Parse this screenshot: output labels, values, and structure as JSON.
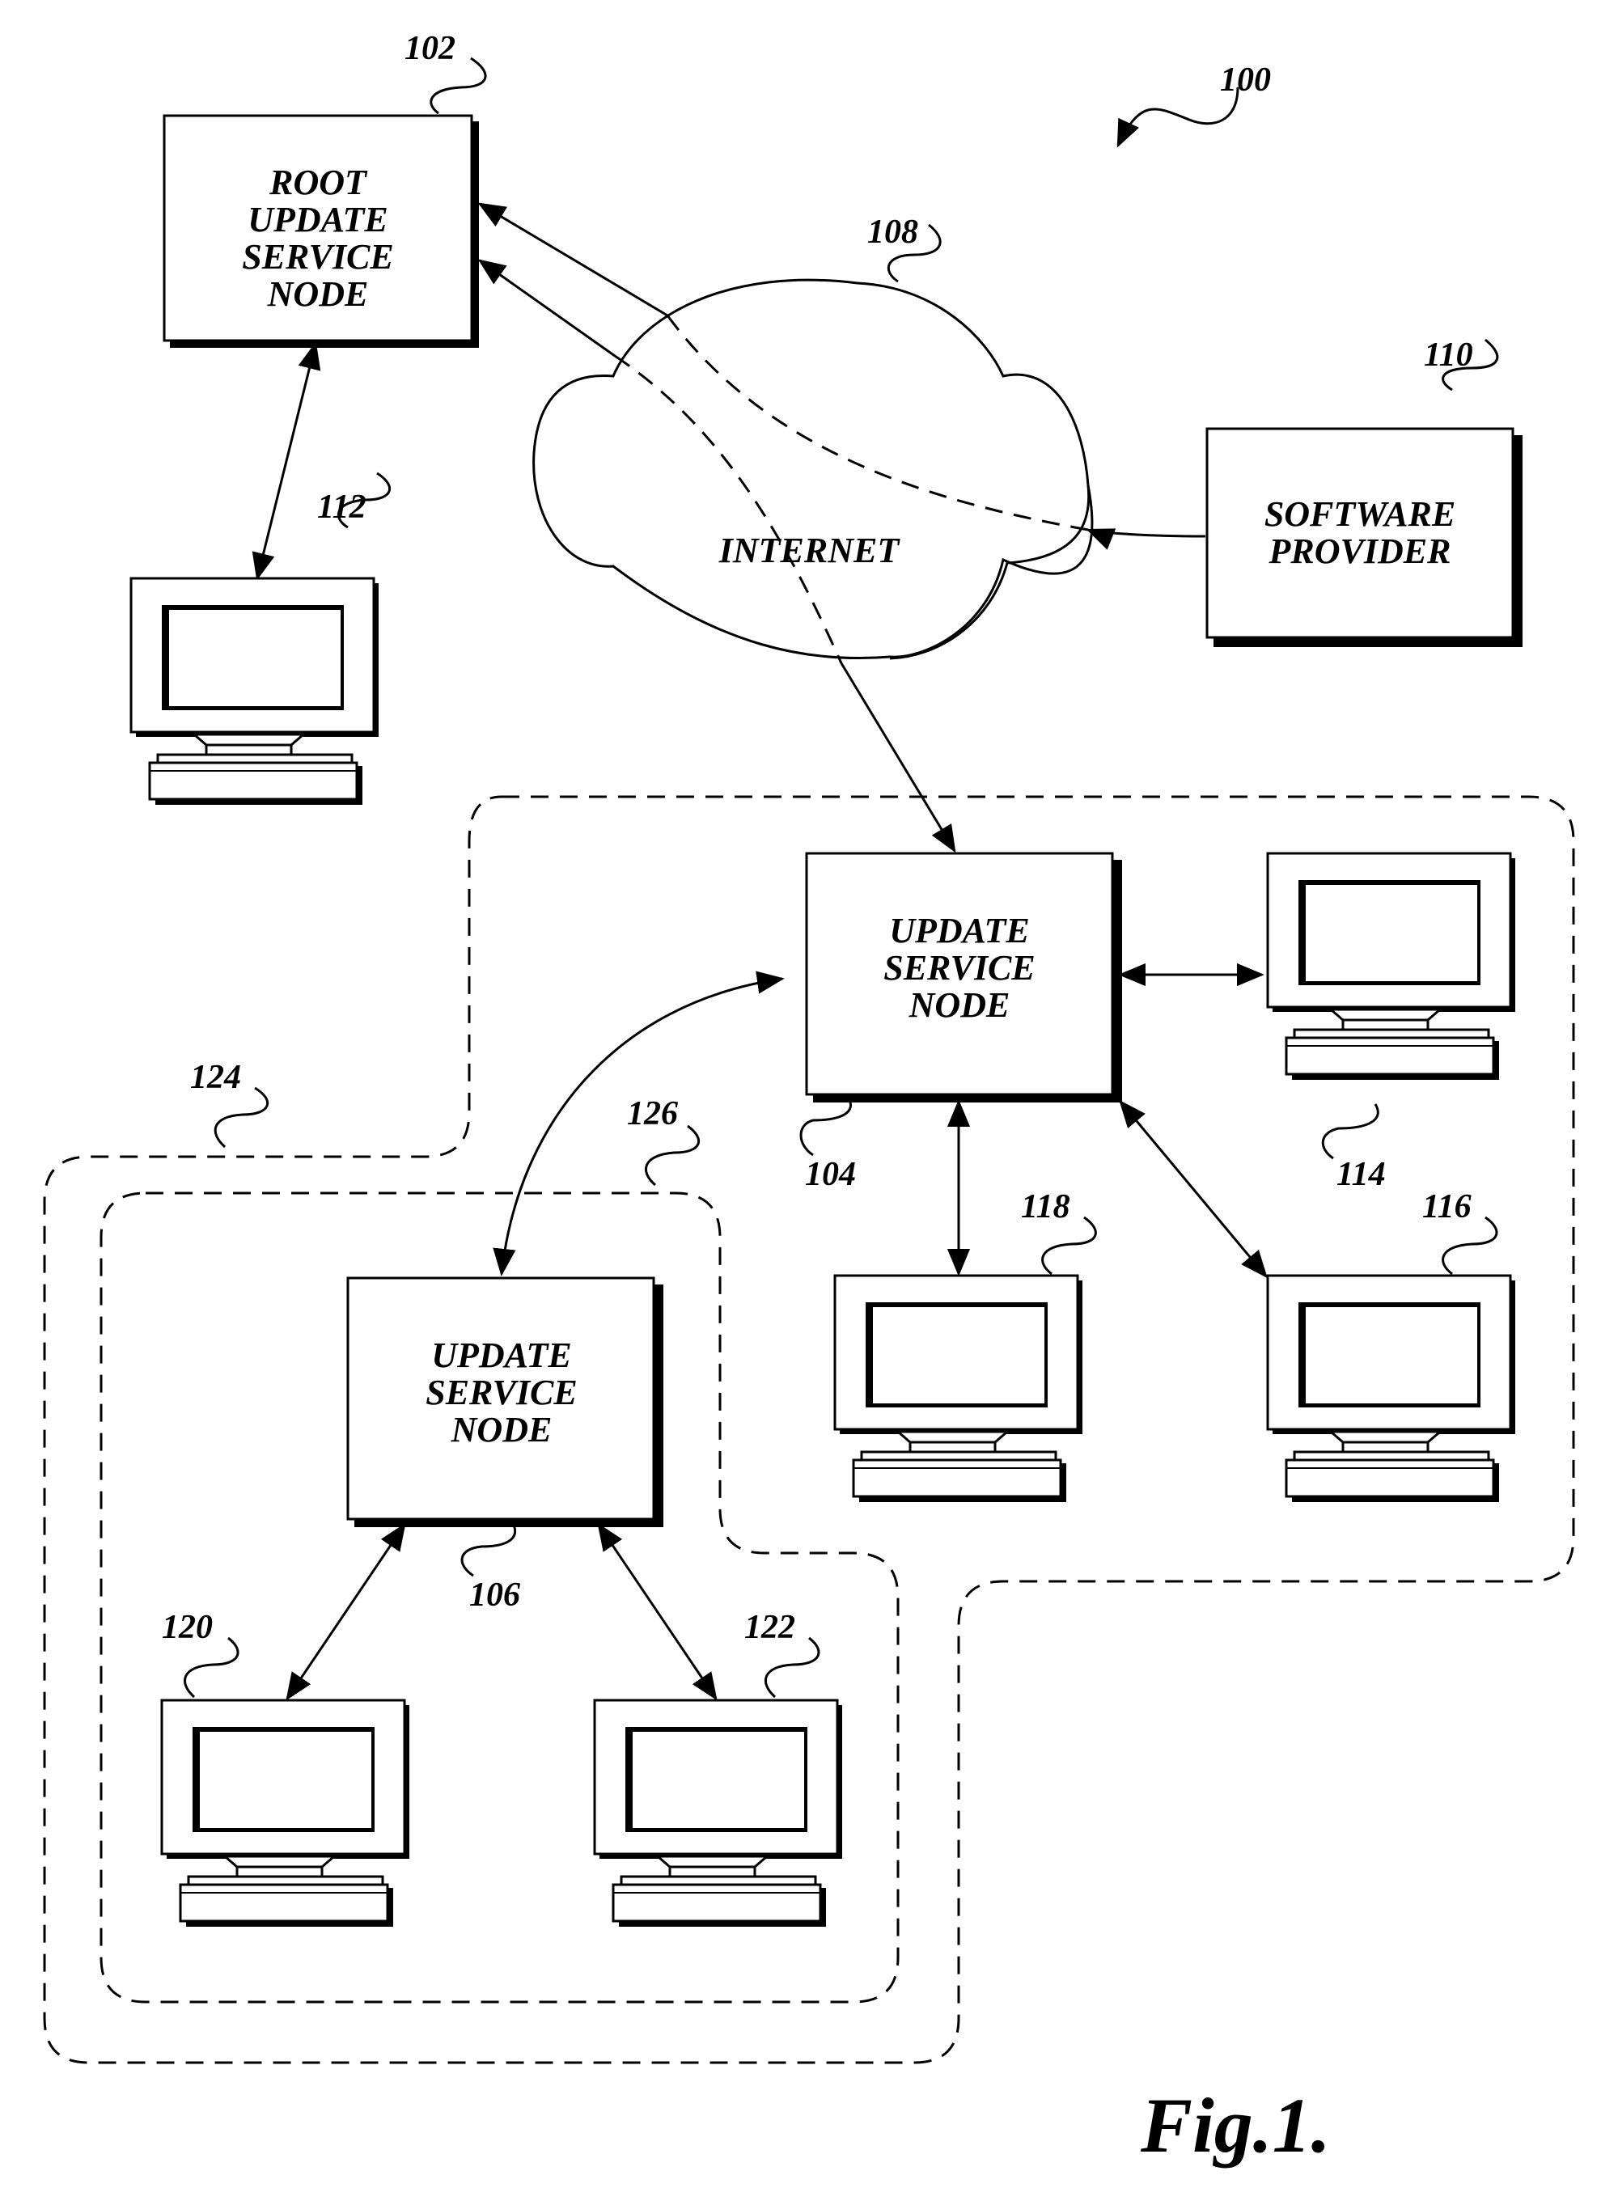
{
  "figure": {
    "caption": "Fig.1.",
    "system_ref": "100"
  },
  "nodes": {
    "root": {
      "ref": "102",
      "lines": [
        "ROOT",
        "UPDATE",
        "SERVICE",
        "NODE"
      ]
    },
    "internet": {
      "ref": "108",
      "label": "INTERNET"
    },
    "software_provider": {
      "ref": "110",
      "lines": [
        "SOFTWARE",
        "PROVIDER"
      ]
    },
    "node_104": {
      "ref": "104",
      "lines": [
        "UPDATE",
        "SERVICE",
        "NODE"
      ]
    },
    "node_106": {
      "ref": "106",
      "lines": [
        "UPDATE",
        "SERVICE",
        "NODE"
      ]
    }
  },
  "computers": [
    {
      "ref": "112"
    },
    {
      "ref": "114"
    },
    {
      "ref": "116"
    },
    {
      "ref": "118"
    },
    {
      "ref": "120"
    },
    {
      "ref": "122"
    }
  ],
  "regions": {
    "outer": {
      "ref": "124"
    },
    "inner": {
      "ref": "126"
    }
  }
}
